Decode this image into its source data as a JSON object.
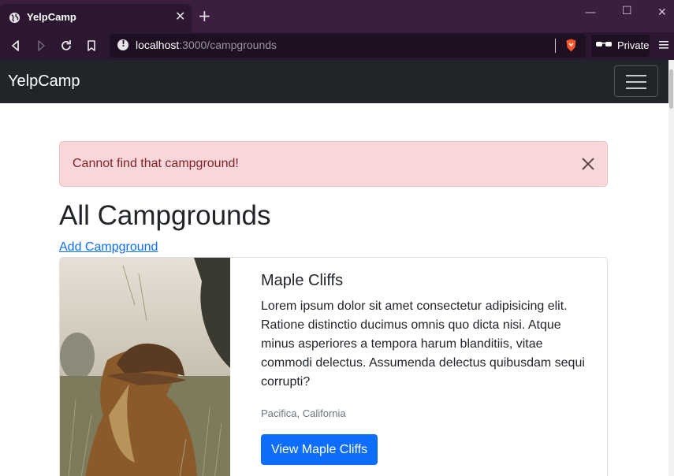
{
  "browser": {
    "tab_title": "YelpCamp",
    "url_host": "localhost",
    "url_path": ":3000/campgrounds",
    "private_label": "Private",
    "icons": [
      "globe-icon",
      "close-icon",
      "plus-icon",
      "back-icon",
      "forward-icon",
      "reload-icon",
      "bookmark-icon",
      "info-icon",
      "brave-shield-icon",
      "private-glasses-icon",
      "hamburger-menu-icon"
    ]
  },
  "navbar": {
    "brand": "YelpCamp"
  },
  "alert": {
    "message": "Cannot find that campground!"
  },
  "main": {
    "title": "All Campgrounds",
    "add_link": "Add Campground"
  },
  "campgrounds": [
    {
      "title": "Maple Cliffs",
      "description": "Lorem ipsum dolor sit amet consectetur adipisicing elit. Ratione distinctio ducimus omnis quo dicta nisi. Atque minus asperiores a tempora harum blanditiis, vitae commodi delectus. Assumenda delectus quibusdam sequi corrupti?",
      "location": "Pacifica, California",
      "button_label": "View Maple Cliffs"
    }
  ],
  "colors": {
    "tabbar": "#3a1f3e",
    "toolbar": "#2b1830",
    "navbar": "#212529",
    "alert_bg": "#f8d7da",
    "alert_text": "#842029",
    "primary": "#0d6efd",
    "link": "#0d6efd"
  }
}
